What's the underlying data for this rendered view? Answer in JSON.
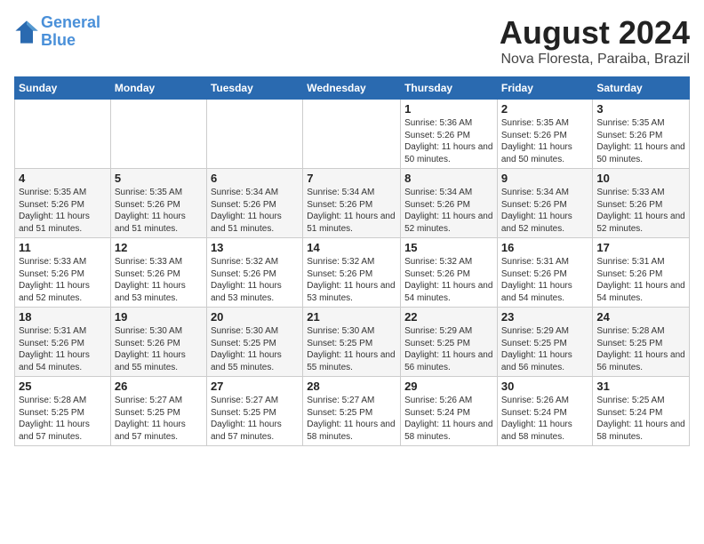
{
  "header": {
    "logo_line1": "General",
    "logo_line2": "Blue",
    "main_title": "August 2024",
    "sub_title": "Nova Floresta, Paraiba, Brazil"
  },
  "days_of_week": [
    "Sunday",
    "Monday",
    "Tuesday",
    "Wednesday",
    "Thursday",
    "Friday",
    "Saturday"
  ],
  "weeks": [
    [
      {
        "day": "",
        "info": ""
      },
      {
        "day": "",
        "info": ""
      },
      {
        "day": "",
        "info": ""
      },
      {
        "day": "",
        "info": ""
      },
      {
        "day": "1",
        "info": "Sunrise: 5:36 AM\nSunset: 5:26 PM\nDaylight: 11 hours and 50 minutes."
      },
      {
        "day": "2",
        "info": "Sunrise: 5:35 AM\nSunset: 5:26 PM\nDaylight: 11 hours and 50 minutes."
      },
      {
        "day": "3",
        "info": "Sunrise: 5:35 AM\nSunset: 5:26 PM\nDaylight: 11 hours and 50 minutes."
      }
    ],
    [
      {
        "day": "4",
        "info": "Sunrise: 5:35 AM\nSunset: 5:26 PM\nDaylight: 11 hours and 51 minutes."
      },
      {
        "day": "5",
        "info": "Sunrise: 5:35 AM\nSunset: 5:26 PM\nDaylight: 11 hours and 51 minutes."
      },
      {
        "day": "6",
        "info": "Sunrise: 5:34 AM\nSunset: 5:26 PM\nDaylight: 11 hours and 51 minutes."
      },
      {
        "day": "7",
        "info": "Sunrise: 5:34 AM\nSunset: 5:26 PM\nDaylight: 11 hours and 51 minutes."
      },
      {
        "day": "8",
        "info": "Sunrise: 5:34 AM\nSunset: 5:26 PM\nDaylight: 11 hours and 52 minutes."
      },
      {
        "day": "9",
        "info": "Sunrise: 5:34 AM\nSunset: 5:26 PM\nDaylight: 11 hours and 52 minutes."
      },
      {
        "day": "10",
        "info": "Sunrise: 5:33 AM\nSunset: 5:26 PM\nDaylight: 11 hours and 52 minutes."
      }
    ],
    [
      {
        "day": "11",
        "info": "Sunrise: 5:33 AM\nSunset: 5:26 PM\nDaylight: 11 hours and 52 minutes."
      },
      {
        "day": "12",
        "info": "Sunrise: 5:33 AM\nSunset: 5:26 PM\nDaylight: 11 hours and 53 minutes."
      },
      {
        "day": "13",
        "info": "Sunrise: 5:32 AM\nSunset: 5:26 PM\nDaylight: 11 hours and 53 minutes."
      },
      {
        "day": "14",
        "info": "Sunrise: 5:32 AM\nSunset: 5:26 PM\nDaylight: 11 hours and 53 minutes."
      },
      {
        "day": "15",
        "info": "Sunrise: 5:32 AM\nSunset: 5:26 PM\nDaylight: 11 hours and 54 minutes."
      },
      {
        "day": "16",
        "info": "Sunrise: 5:31 AM\nSunset: 5:26 PM\nDaylight: 11 hours and 54 minutes."
      },
      {
        "day": "17",
        "info": "Sunrise: 5:31 AM\nSunset: 5:26 PM\nDaylight: 11 hours and 54 minutes."
      }
    ],
    [
      {
        "day": "18",
        "info": "Sunrise: 5:31 AM\nSunset: 5:26 PM\nDaylight: 11 hours and 54 minutes."
      },
      {
        "day": "19",
        "info": "Sunrise: 5:30 AM\nSunset: 5:26 PM\nDaylight: 11 hours and 55 minutes."
      },
      {
        "day": "20",
        "info": "Sunrise: 5:30 AM\nSunset: 5:25 PM\nDaylight: 11 hours and 55 minutes."
      },
      {
        "day": "21",
        "info": "Sunrise: 5:30 AM\nSunset: 5:25 PM\nDaylight: 11 hours and 55 minutes."
      },
      {
        "day": "22",
        "info": "Sunrise: 5:29 AM\nSunset: 5:25 PM\nDaylight: 11 hours and 56 minutes."
      },
      {
        "day": "23",
        "info": "Sunrise: 5:29 AM\nSunset: 5:25 PM\nDaylight: 11 hours and 56 minutes."
      },
      {
        "day": "24",
        "info": "Sunrise: 5:28 AM\nSunset: 5:25 PM\nDaylight: 11 hours and 56 minutes."
      }
    ],
    [
      {
        "day": "25",
        "info": "Sunrise: 5:28 AM\nSunset: 5:25 PM\nDaylight: 11 hours and 57 minutes."
      },
      {
        "day": "26",
        "info": "Sunrise: 5:27 AM\nSunset: 5:25 PM\nDaylight: 11 hours and 57 minutes."
      },
      {
        "day": "27",
        "info": "Sunrise: 5:27 AM\nSunset: 5:25 PM\nDaylight: 11 hours and 57 minutes."
      },
      {
        "day": "28",
        "info": "Sunrise: 5:27 AM\nSunset: 5:25 PM\nDaylight: 11 hours and 58 minutes."
      },
      {
        "day": "29",
        "info": "Sunrise: 5:26 AM\nSunset: 5:24 PM\nDaylight: 11 hours and 58 minutes."
      },
      {
        "day": "30",
        "info": "Sunrise: 5:26 AM\nSunset: 5:24 PM\nDaylight: 11 hours and 58 minutes."
      },
      {
        "day": "31",
        "info": "Sunrise: 5:25 AM\nSunset: 5:24 PM\nDaylight: 11 hours and 58 minutes."
      }
    ]
  ]
}
